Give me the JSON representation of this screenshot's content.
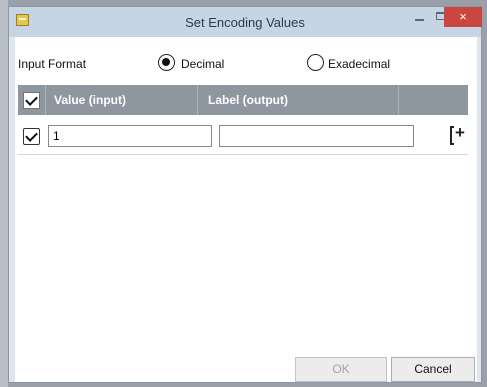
{
  "window": {
    "title": "Set Encoding Values",
    "close_glyph": "×"
  },
  "input_format": {
    "label": "Input Format",
    "options": [
      {
        "label": "Decimal",
        "selected": true
      },
      {
        "label": "Exadecimal",
        "selected": false
      }
    ]
  },
  "table": {
    "headers": [
      "Value (input)",
      "Label (output)"
    ],
    "rows": [
      {
        "checked": true,
        "value": "1",
        "label": ""
      }
    ],
    "add_glyph": "+"
  },
  "buttons": {
    "ok": "OK",
    "cancel": "Cancel"
  },
  "colors": {
    "header_bg": "#8e96a0",
    "close_bg": "#c9473f",
    "titlebar_bg": "#c6d4e3"
  }
}
